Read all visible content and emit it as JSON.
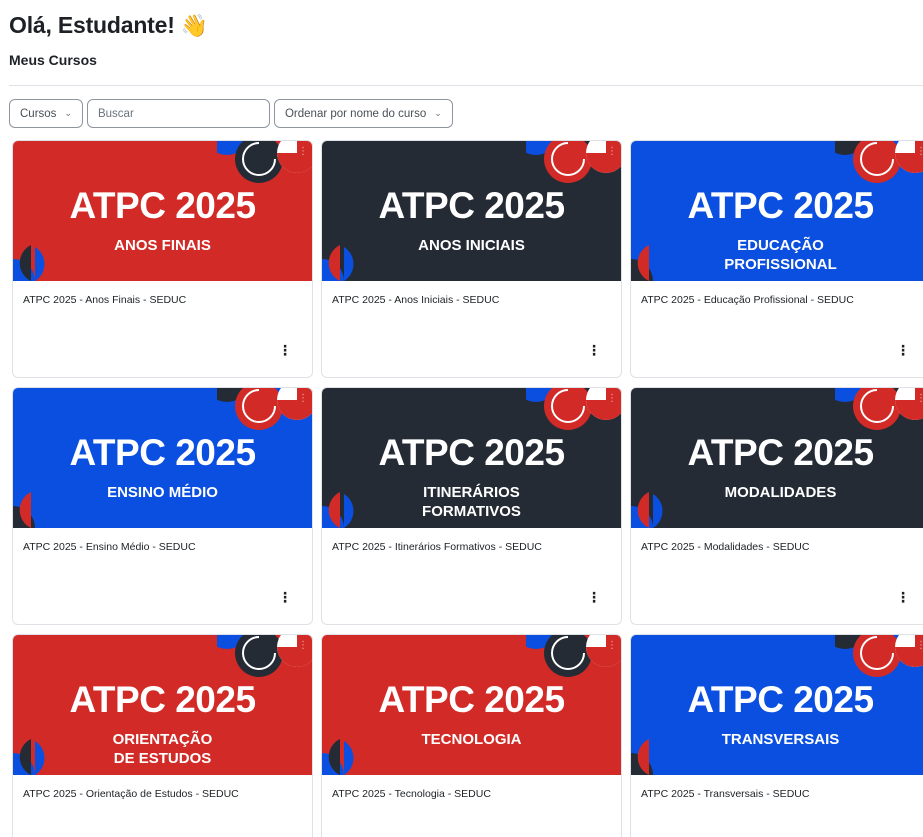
{
  "header": {
    "greeting": "Olá, Estudante!",
    "wave_icon": "👋",
    "section_title": "Meus Cursos"
  },
  "filters": {
    "type_label": "Cursos",
    "search_placeholder": "Buscar",
    "sort_label": "Ordenar por nome do curso"
  },
  "courses": [
    {
      "theme": "red",
      "banner_title": "ATPC 2025",
      "banner_subtitle": "ANOS FINAIS",
      "name": "ATPC 2025 - Anos Finais - SEDUC"
    },
    {
      "theme": "dark",
      "banner_title": "ATPC 2025",
      "banner_subtitle": "ANOS INICIAIS",
      "name": "ATPC 2025 - Anos Iniciais - SEDUC"
    },
    {
      "theme": "blue",
      "banner_title": "ATPC 2025",
      "banner_subtitle": "EDUCAÇÃO\nPROFISSIONAL",
      "name": "ATPC 2025 - Educação Profissional - SEDUC"
    },
    {
      "theme": "blue",
      "banner_title": "ATPC 2025",
      "banner_subtitle": "ENSINO MÉDIO",
      "name": "ATPC 2025 - Ensino Médio - SEDUC"
    },
    {
      "theme": "dark",
      "banner_title": "ATPC 2025",
      "banner_subtitle": "ITINERÁRIOS\nFORMATIVOS",
      "name": "ATPC 2025 - Itinerários Formativos  - SEDUC"
    },
    {
      "theme": "dark",
      "banner_title": "ATPC 2025",
      "banner_subtitle": "MODALIDADES",
      "name": "ATPC 2025 - Modalidades - SEDUC"
    },
    {
      "theme": "red",
      "banner_title": "ATPC 2025",
      "banner_subtitle": "ORIENTAÇÃO\nDE ESTUDOS",
      "name": "ATPC 2025 - Orientação de Estudos - SEDUC"
    },
    {
      "theme": "red",
      "banner_title": "ATPC 2025",
      "banner_subtitle": "TECNOLOGIA",
      "name": "ATPC 2025 - Tecnologia - SEDUC"
    },
    {
      "theme": "blue",
      "banner_title": "ATPC 2025",
      "banner_subtitle": "TRANSVERSAIS",
      "name": "ATPC 2025 - Transversais - SEDUC"
    }
  ],
  "colors": {
    "red": "#d22b27",
    "dark": "#252b35",
    "blue": "#0b4fe0"
  }
}
